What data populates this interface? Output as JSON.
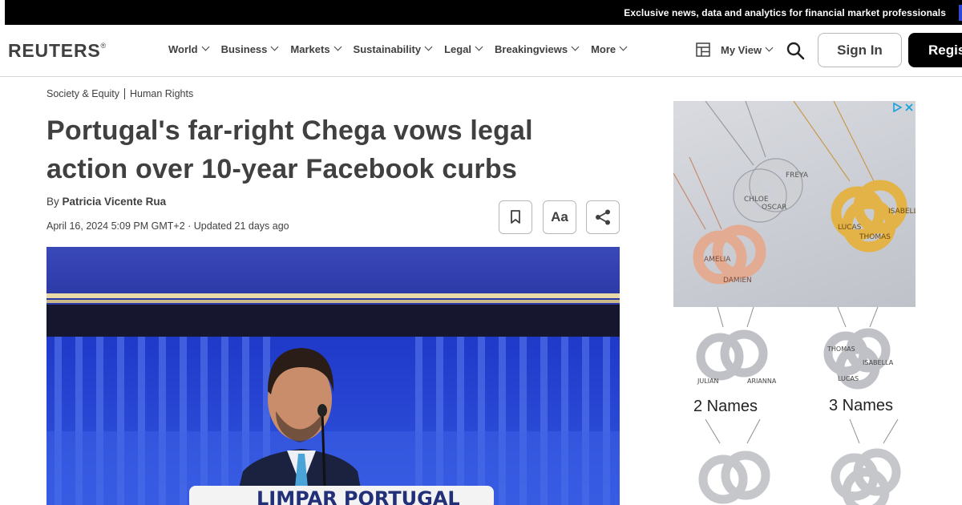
{
  "topbar": {
    "text": "Exclusive news, data and analytics for financial market professionals"
  },
  "header": {
    "logo": "REUTERS",
    "logo_mark": "®",
    "nav": [
      "World",
      "Business",
      "Markets",
      "Sustainability",
      "Legal",
      "Breakingviews",
      "More"
    ],
    "my_view": "My View",
    "sign_in": "Sign In",
    "register": "Register"
  },
  "article": {
    "breadcrumbs": [
      "Society & Equity",
      "Human Rights"
    ],
    "title": "Portugal's far-right Chega vows legal action over 10-year Facebook curbs",
    "by_prefix": "By",
    "author": "Patricia Vicente Rua",
    "dateline": "April 16, 2024 5:09 PM GMT+2 · Updated 21 days ago",
    "text_size_label": "Aa",
    "photo_banner_text": "LIMPAR PORTUGAL"
  },
  "ad": {
    "necklace_names_1": [
      "CHLOE",
      "OSCAR",
      "FREYA"
    ],
    "necklace_names_2": [
      "LUCAS",
      "THOMAS",
      "ISABELLA"
    ],
    "necklace_names_3": [
      "AMELIA",
      "DAMIEN"
    ],
    "necklace_names_4": [
      "JULIAN",
      "ARIANNA"
    ],
    "necklace_names_5": [
      "THOMAS",
      "LUCAS",
      "ISABELLA"
    ],
    "label_1": "2 Names",
    "label_2": "3 Names"
  },
  "colors": {
    "text": "#404040",
    "topbar_bg": "#000000",
    "register_bg": "#000000",
    "accent": "#2f48d8",
    "photo_blue": "#2c37a6"
  },
  "icons": [
    "my-view-icon",
    "search-icon",
    "bookmark-icon",
    "share-icon",
    "adchoices-icon",
    "ad-close-icon"
  ]
}
